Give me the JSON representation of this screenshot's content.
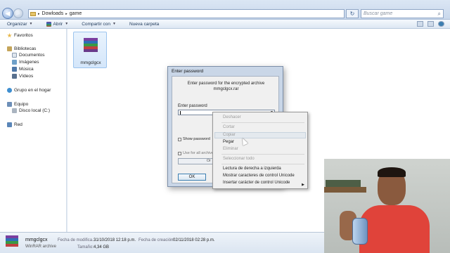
{
  "addressbar": {
    "crumb1": "Dowloads",
    "sep": "▸",
    "crumb2": "game"
  },
  "search": {
    "placeholder": "Buscar game"
  },
  "toolbar": {
    "organize": "Organizar",
    "open": "Abrir",
    "share": "Compartir con",
    "new_folder": "Nueva carpeta"
  },
  "navpane": {
    "favorites": "Favoritos",
    "libraries": "Bibliotecas",
    "documents": "Documentos",
    "images": "Imágenes",
    "music": "Música",
    "videos": "Vídeos",
    "homegroup": "Grupo en el hogar",
    "computer": "Equipo",
    "local_disk": "Disco local (C:)",
    "network": "Red"
  },
  "file": {
    "name": "mmgclgcx"
  },
  "dialog": {
    "title": "Enter password",
    "message_line1": "Enter password for the encrypted archive",
    "message_line2": "mmgclgcx.rar",
    "enter_password_label": "Enter password",
    "show_password": "Show password",
    "use_for_all": "Use for all archives",
    "organize_btn": "Or",
    "ok": "OK"
  },
  "context_menu": {
    "items": [
      "Deshacer",
      "Cortar",
      "Copiar",
      "Pegar",
      "Eliminar",
      "Seleccionar todo",
      "Lectura de derecha a izquierda",
      "Mostrar caracteres de control Unicode",
      "Insertar carácter de control Unicode"
    ]
  },
  "details": {
    "name": "mmgclgcx",
    "type": "WinRAR archive",
    "modified_label": "Fecha de modifica...",
    "modified_value": "31/10/2018 12:18 p.m.",
    "created_label": "Fecha de creación:",
    "created_value": "02/11/2018 02:28 p.m.",
    "size_label": "Tamaño:",
    "size_value": "4,34 GB"
  },
  "colors": {
    "accent": "#3c7fb1",
    "webcam_shirt": "#e0433a"
  }
}
